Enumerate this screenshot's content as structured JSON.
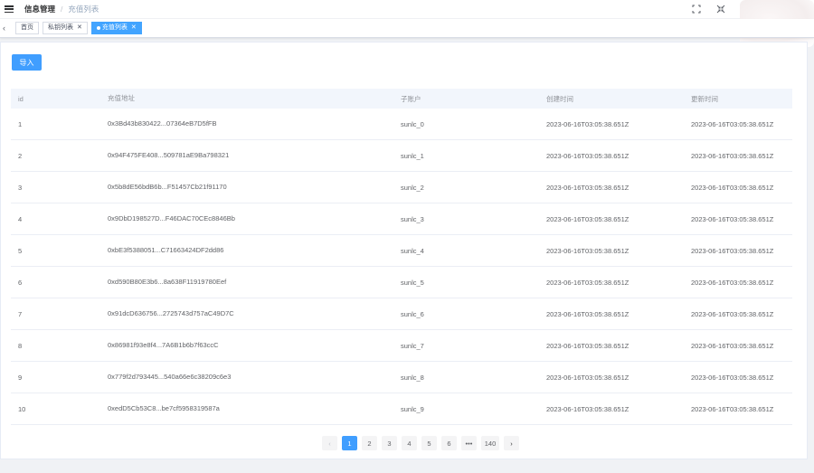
{
  "header": {
    "breadcrumb_root": "信息管理",
    "breadcrumb_sep": "/",
    "breadcrumb_current": "充值列表"
  },
  "tags": [
    {
      "label": "首页",
      "closable": false,
      "active": false
    },
    {
      "label": "私钥列表",
      "closable": true,
      "active": false
    },
    {
      "label": "充值列表",
      "closable": true,
      "active": true
    }
  ],
  "toolbar": {
    "import_label": "导入"
  },
  "table": {
    "columns": [
      "id",
      "充值地址",
      "",
      "子账户",
      "创建时间",
      "更新时间"
    ],
    "rows": [
      {
        "id": "1",
        "address": "0x3Bd43b830422...07364eB7D5fFB",
        "sub": "sunlc_0",
        "created": "2023-06-16T03:05:38.651Z",
        "updated": "2023-06-16T03:05:38.651Z"
      },
      {
        "id": "2",
        "address": "0x94F475FE408...509781aE9Ba798321",
        "sub": "sunlc_1",
        "created": "2023-06-16T03:05:38.651Z",
        "updated": "2023-06-16T03:05:38.651Z"
      },
      {
        "id": "3",
        "address": "0x5b8dE56bdB6b...F51457Cb21f91170",
        "sub": "sunlc_2",
        "created": "2023-06-16T03:05:38.651Z",
        "updated": "2023-06-16T03:05:38.651Z"
      },
      {
        "id": "4",
        "address": "0x9DbD198527D...F46DAC70CEc8846Bb",
        "sub": "sunlc_3",
        "created": "2023-06-16T03:05:38.651Z",
        "updated": "2023-06-16T03:05:38.651Z"
      },
      {
        "id": "5",
        "address": "0xbE3f5388051...C71663424DF2dd86",
        "sub": "sunlc_4",
        "created": "2023-06-16T03:05:38.651Z",
        "updated": "2023-06-16T03:05:38.651Z"
      },
      {
        "id": "6",
        "address": "0xd590B80E3b6...8a638F11919780Eef",
        "sub": "sunlc_5",
        "created": "2023-06-16T03:05:38.651Z",
        "updated": "2023-06-16T03:05:38.651Z"
      },
      {
        "id": "7",
        "address": "0x91dcD636756...2725743d757aC49D7C",
        "sub": "sunlc_6",
        "created": "2023-06-16T03:05:38.651Z",
        "updated": "2023-06-16T03:05:38.651Z"
      },
      {
        "id": "8",
        "address": "0x86981f93e8f4...7A6B1b6b7f63ccC",
        "sub": "sunlc_7",
        "created": "2023-06-16T03:05:38.651Z",
        "updated": "2023-06-16T03:05:38.651Z"
      },
      {
        "id": "9",
        "address": "0x779f2d793445...540a66e6c38209c6e3",
        "sub": "sunlc_8",
        "created": "2023-06-16T03:05:38.651Z",
        "updated": "2023-06-16T03:05:38.651Z"
      },
      {
        "id": "10",
        "address": "0xedD5Cb53C8...be7cf5958319587a",
        "sub": "sunlc_9",
        "created": "2023-06-16T03:05:38.651Z",
        "updated": "2023-06-16T03:05:38.651Z"
      }
    ]
  },
  "pagination": {
    "prev": "‹",
    "next": "›",
    "pages": [
      "1",
      "2",
      "3",
      "4",
      "5",
      "6"
    ],
    "ellipsis": "•••",
    "last": "140",
    "current": "1"
  },
  "colors": {
    "primary": "#409eff",
    "active_tag": "#42a4ff"
  },
  "icons": [
    "hamburger-icon",
    "fullscreen-icon",
    "size-icon",
    "back-arrow-icon",
    "close-icon",
    "avatar"
  ]
}
